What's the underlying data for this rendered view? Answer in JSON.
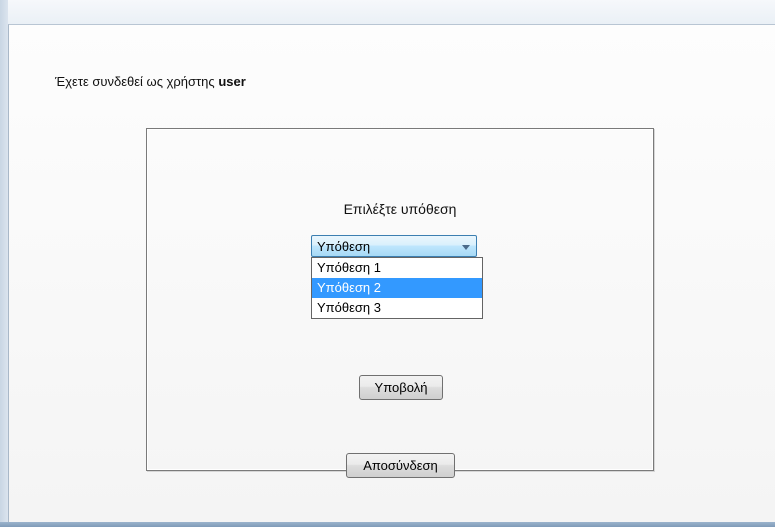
{
  "login_status": {
    "prefix": "Έχετε συνδεθεί ως χρήστης",
    "username": "user"
  },
  "form": {
    "prompt": "Επιλέξτε υπόθεση",
    "select": {
      "value": "Υπόθεση",
      "options": [
        {
          "label": "Υπόθεση 1",
          "highlighted": false
        },
        {
          "label": "Υπόθεση 2",
          "highlighted": true
        },
        {
          "label": "Υπόθεση 3",
          "highlighted": false
        }
      ]
    },
    "submit_label": "Υποβολή",
    "logout_label": "Αποσύνδεση"
  },
  "colors": {
    "highlight": "#3399ff",
    "window_border": "#7f9bb8"
  },
  "icons": {
    "dropdown": "chevron-down-icon"
  }
}
